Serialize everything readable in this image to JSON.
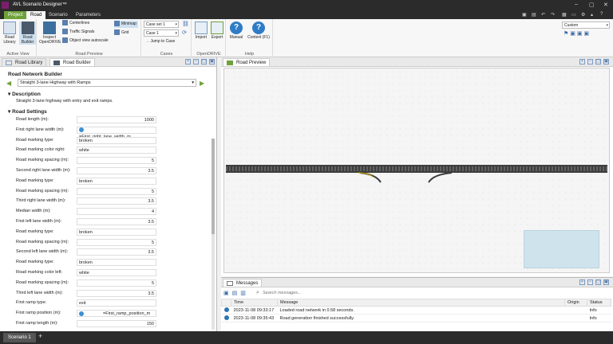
{
  "app": {
    "title": "AVL Scenario Designer™",
    "window_min": "–",
    "window_max": "▢",
    "window_close": "✕"
  },
  "ribbon_tabs": [
    "Project",
    "Road",
    "Scenario",
    "Parameters"
  ],
  "ribbon": {
    "active_view": {
      "label": "Active View",
      "road_library": "Road Library",
      "road_builder": "Road Builder"
    },
    "road_preview": {
      "label": "Road Preview",
      "inspect": "Inspect OpenDRIVE",
      "centerlines": "Centerlines",
      "traffic_signals": "Traffic Signals",
      "object_view_autoscale": "Object view autoscale",
      "minimap": "Minimap",
      "grid": "Grid"
    },
    "cases": {
      "label": "Cases",
      "case_set": "Case set 1",
      "case": "Case 1",
      "jump": "Jump to Case"
    },
    "opendrive": {
      "label": "OpenDRIVE",
      "import": "Import",
      "export": "Export"
    },
    "help": {
      "label": "Help",
      "manual": "Manual",
      "context": "Context (F1)"
    },
    "layout": {
      "value": "Custom"
    }
  },
  "left_tabs": [
    "Road Library",
    "Road Builder"
  ],
  "builder": {
    "title": "Road Network Builder",
    "template": "Straight 3-lane Highway with Ramps",
    "description_header": "Description",
    "description": "Straight 3-lane highway with entry and exit ramps.",
    "settings_header": "Road Settings",
    "fields": [
      {
        "label": "Road length (m):",
        "value": "1000",
        "num": true
      },
      {
        "label": "First right lane width (m):",
        "value": "=First_right_lane_width_m",
        "formula": true
      },
      {
        "label": "Road marking type:",
        "value": "broken"
      },
      {
        "label": "Road marking color right:",
        "value": "white"
      },
      {
        "label": "Road marking spacing (m):",
        "value": "5",
        "num": true
      },
      {
        "label": "Second right lane width (m):",
        "value": "3.5",
        "num": true
      },
      {
        "label": "Road marking type:",
        "value": "broken"
      },
      {
        "label": "Road marking spacing (m):",
        "value": "5",
        "num": true
      },
      {
        "label": "Third right lane width (m):",
        "value": "3.5",
        "num": true
      },
      {
        "label": "Median width (m):",
        "value": "4",
        "num": true
      },
      {
        "label": "First left lane width (m):",
        "value": "3.5",
        "num": true
      },
      {
        "label": "Road marking type:",
        "value": "broken"
      },
      {
        "label": "Road marking spacing (m):",
        "value": "5",
        "num": true
      },
      {
        "label": "Second left lane width (m):",
        "value": "3.5",
        "num": true
      },
      {
        "label": "Road marking type:",
        "value": "broken"
      },
      {
        "label": "Road marking color left:",
        "value": "white"
      },
      {
        "label": "Road marking spacing (m):",
        "value": "5",
        "num": true
      },
      {
        "label": "Third left lane width (m):",
        "value": "3.5",
        "num": true
      },
      {
        "label": "First ramp type:",
        "value": "exit"
      },
      {
        "label": "First ramp position (m):",
        "value": "=First_ramp_position_m",
        "formula": true
      },
      {
        "label": "First ramp length (m):",
        "value": "150",
        "num": true
      }
    ]
  },
  "preview_tab": "Road Preview",
  "messages": {
    "tab": "Messages",
    "search_placeholder": "Search messages...",
    "columns": [
      "Time",
      "Message",
      "Origin",
      "Status"
    ],
    "rows": [
      {
        "time": "2023-11-08 09:33:17",
        "message": "Loaded road network in 0.58 seconds.",
        "origin": "",
        "status": "Info"
      },
      {
        "time": "2023-11-08 09:35:43",
        "message": "Road generation finished successfully.",
        "origin": "",
        "status": "Info"
      }
    ]
  },
  "status": {
    "scenario_tab": "Scenario 1",
    "add": "+"
  },
  "colors": {
    "accent": "#6fa13a",
    "brand": "#7a1f6b",
    "titlebar": "#2b2b2b"
  }
}
